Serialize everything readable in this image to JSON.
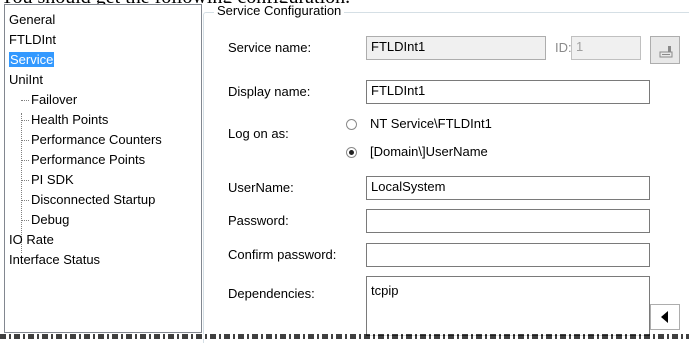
{
  "caption": "You should get the following configuration.",
  "tree": {
    "items": [
      {
        "label": "General",
        "level": 0,
        "selected": false
      },
      {
        "label": "FTLDInt",
        "level": 0,
        "selected": false
      },
      {
        "label": "Service",
        "level": 0,
        "selected": true
      },
      {
        "label": "UniInt",
        "level": 0,
        "selected": false
      },
      {
        "label": "Failover",
        "level": 1,
        "selected": false
      },
      {
        "label": "Health Points",
        "level": 1,
        "selected": false
      },
      {
        "label": "Performance Counters",
        "level": 1,
        "selected": false
      },
      {
        "label": "Performance Points",
        "level": 1,
        "selected": false
      },
      {
        "label": "PI SDK",
        "level": 1,
        "selected": false
      },
      {
        "label": "Disconnected Startup",
        "level": 1,
        "selected": false
      },
      {
        "label": "Debug",
        "level": 1,
        "selected": false
      },
      {
        "label": "IO Rate",
        "level": 0,
        "selected": false
      },
      {
        "label": "Interface Status",
        "level": 0,
        "selected": false
      }
    ]
  },
  "service_config": {
    "title": "Service Configuration",
    "service_name_label": "Service name:",
    "service_name_value": "FTLDInt1",
    "id_label": "ID:",
    "id_value": "1",
    "display_name_label": "Display name:",
    "display_name_value": "FTLDInt1",
    "logon_label": "Log on as:",
    "logon_option_1": "NT Service\\FTLDInt1",
    "logon_option_2": "[Domain\\]UserName",
    "logon_selected": 2,
    "username_label": "UserName:",
    "username_value": "LocalSystem",
    "password_label": "Password:",
    "password_value": "",
    "confirm_password_label": "Confirm password:",
    "confirm_password_value": "",
    "dependencies_label": "Dependencies:",
    "dependencies_value": "tcpip"
  },
  "icons": {
    "browse": "browse-icon",
    "scroll_left": "arrow-left-icon"
  }
}
